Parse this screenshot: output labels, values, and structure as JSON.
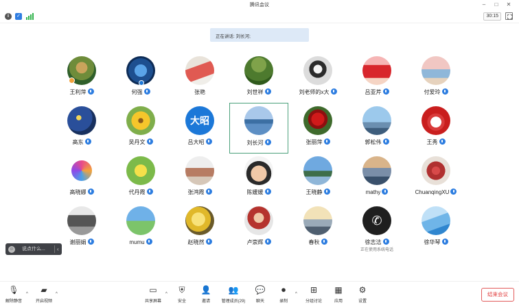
{
  "window": {
    "title": "腾讯会议"
  },
  "status": {
    "timer": "30:15"
  },
  "speaking_banner": "正在讲话: 刘长河;",
  "participants": [
    {
      "name": "王利萍",
      "mic": true
    },
    {
      "name": "何强",
      "mic": true
    },
    {
      "name": "张艳",
      "mic": false
    },
    {
      "name": "刘世祥",
      "mic": true
    },
    {
      "name": "刘老师的x大",
      "mic": true
    },
    {
      "name": "吕亚芹",
      "mic": true
    },
    {
      "name": "付爱玲",
      "mic": true
    },
    {
      "name": "高东",
      "mic": true
    },
    {
      "name": "吴丹文",
      "mic": true
    },
    {
      "name": "吕大昭",
      "mic": true,
      "avatar_text": "大昭"
    },
    {
      "name": "刘长河",
      "mic": true
    },
    {
      "name": "张丽萍",
      "mic": true
    },
    {
      "name": "郭松伟",
      "mic": true
    },
    {
      "name": "王秀",
      "mic": true
    },
    {
      "name": "高晓娜",
      "mic": true
    },
    {
      "name": "代丹霞",
      "mic": true
    },
    {
      "name": "张鸿霞",
      "mic": true
    },
    {
      "name": "陈媛媛",
      "mic": true
    },
    {
      "name": "王晓静",
      "mic": true
    },
    {
      "name": "mathy",
      "mic": true
    },
    {
      "name": "ChuanqingXU",
      "mic": true
    },
    {
      "name": "谢丽娟",
      "mic": true
    },
    {
      "name": "mumu",
      "mic": true
    },
    {
      "name": "赵晓然",
      "mic": true
    },
    {
      "name": "卢崇辉",
      "mic": true
    },
    {
      "name": "春秋",
      "mic": true
    },
    {
      "name": "徐志洁",
      "mic": true,
      "note": "正在使用系统电话"
    },
    {
      "name": "徐华琴",
      "mic": true
    }
  ],
  "chat": {
    "placeholder": "说点什么...",
    "smile": "☺",
    "arrow": "‹"
  },
  "toolbar": {
    "unmute": "解除静音",
    "start_video": "开启视频",
    "share_screen": "共享屏幕",
    "security": "安全",
    "invite": "邀请",
    "participants": "管理成员(29)",
    "chat": "聊天",
    "record": "录制",
    "breakout": "分组讨论",
    "apps": "应用",
    "settings": "设置",
    "end_meeting": "结束会议"
  },
  "colors": {
    "accent": "#2d7de0",
    "end": "#e03b3b",
    "active_border": "#4aa07a"
  }
}
